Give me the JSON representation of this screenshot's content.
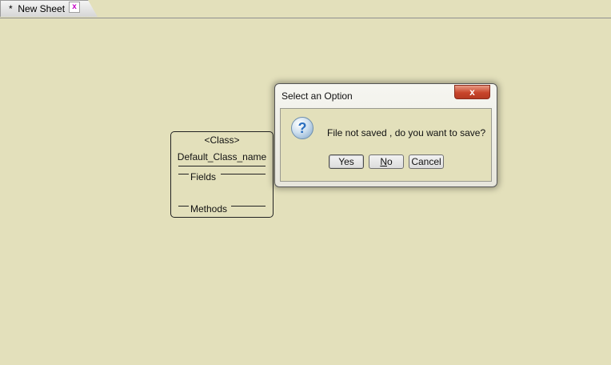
{
  "tab": {
    "label": "*  New Sheet",
    "close_glyph": "x",
    "close_color": "#c400c4"
  },
  "class_box": {
    "stereotype": "<Class>",
    "name": "Default_Class_name",
    "fields_label": "Fields",
    "methods_label": "Methods"
  },
  "dialog": {
    "title": "Select an Option",
    "close_glyph": "x",
    "icon": "question-icon",
    "icon_glyph": "?",
    "message": "File not saved , do you want to save?",
    "buttons": {
      "yes": "Yes",
      "no_mnemonic": "N",
      "no_rest": "o",
      "cancel": "Cancel"
    }
  },
  "colors": {
    "canvas": "#e3e0bb",
    "close_button": "#c8452b"
  }
}
